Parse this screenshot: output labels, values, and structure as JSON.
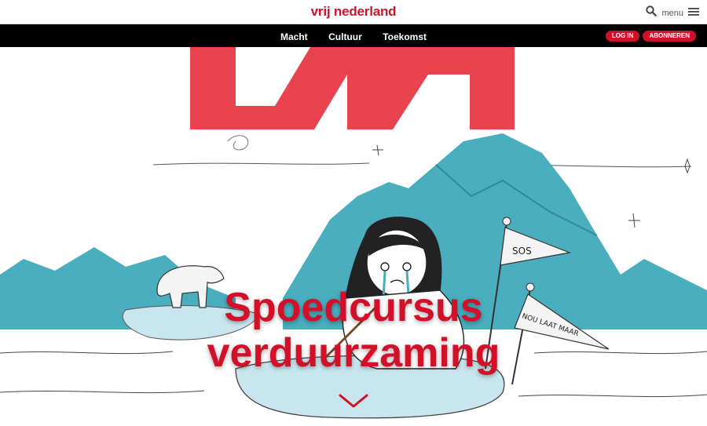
{
  "header": {
    "logo_text": "vrij nederland",
    "menu_label": "menu",
    "search_icon": "search-icon",
    "hamburger_icon": "hamburger-icon"
  },
  "nav": {
    "links": [
      "Macht",
      "Cultuur",
      "Toekomst"
    ],
    "login_label": "LOG IN",
    "subscribe_label": "ABONNEREN"
  },
  "hero": {
    "headline_line1": "Spoedcursus",
    "headline_line2": "verduurzaming",
    "flag1_text": "SOS",
    "flag2_text": "NOU LAAT MAAR",
    "scroll_icon": "chevron-down-icon"
  },
  "colors": {
    "brand_red": "#d2102a",
    "nav_bg": "#000000",
    "ice_blue": "#4aaebf",
    "logo_block_red": "#e8434f"
  }
}
